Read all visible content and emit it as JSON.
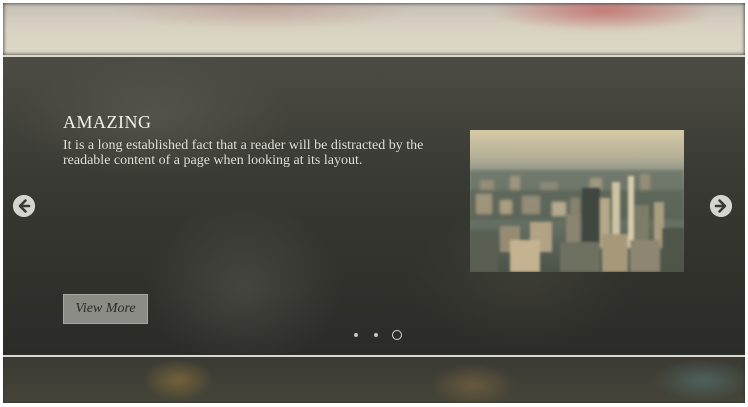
{
  "slide": {
    "title": "AMAZING",
    "text": "It is a long established fact that a reader will be distracted by the readable content of a page when looking at its layout.",
    "button_label": "View More",
    "image_icon": "city-skyline-photo"
  },
  "nav": {
    "prev_icon": "arrow-left-icon",
    "next_icon": "arrow-right-icon"
  },
  "pagination": {
    "total": 3,
    "active_index": 3
  },
  "colors": {
    "panel_border": "#d9d9d2",
    "button_bg": "#8c8c86",
    "title_text": "#f1f1ea"
  }
}
